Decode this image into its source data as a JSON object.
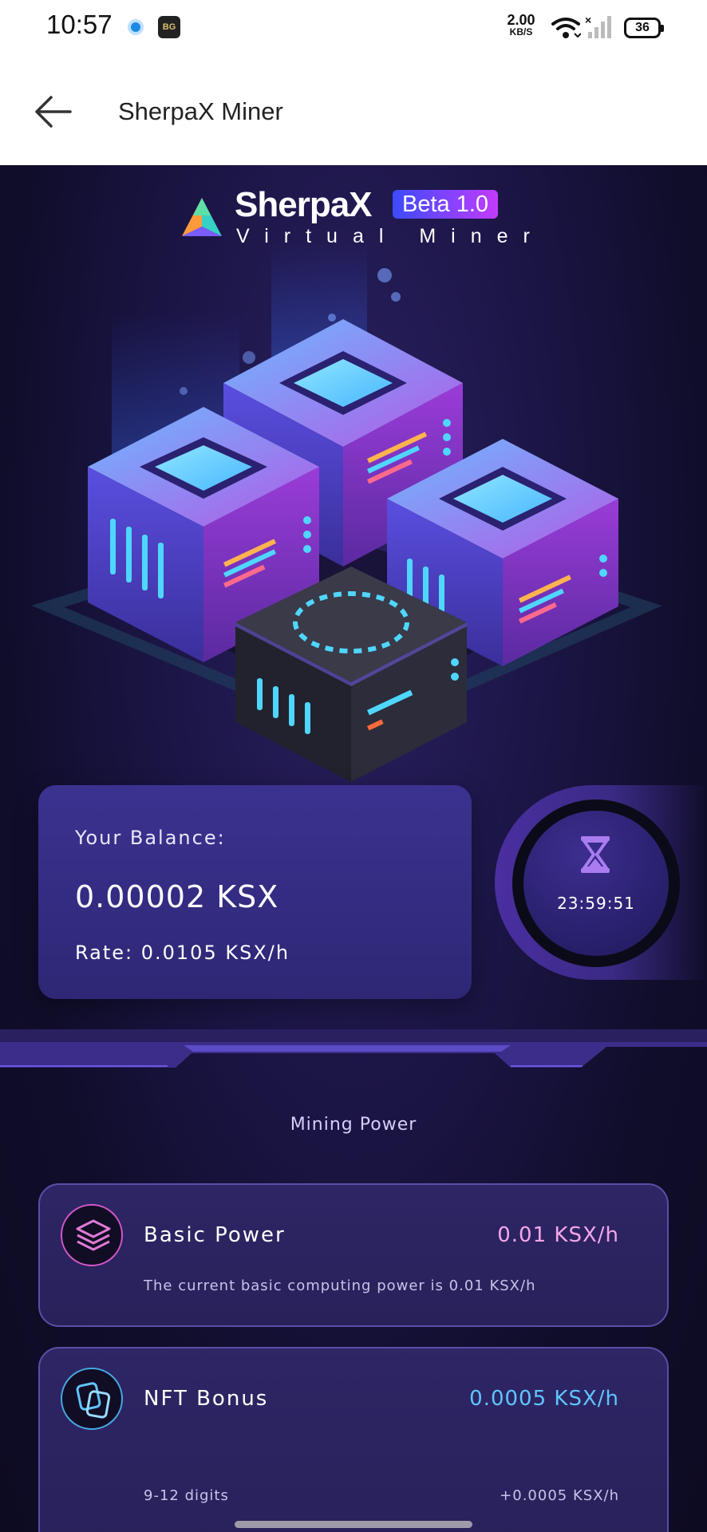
{
  "status_bar": {
    "time": "10:57",
    "app_icon_label": "BG",
    "net_speed_value": "2.00",
    "net_speed_unit": "KB/S",
    "battery": "36",
    "icons": [
      "location-icon",
      "app-icon",
      "wifi-icon",
      "signal-icon",
      "battery-icon"
    ]
  },
  "app_bar": {
    "title": "SherpaX Miner",
    "back_icon": "back-arrow-icon"
  },
  "logo": {
    "name": "SherpaX",
    "badge": "Beta 1.0",
    "subtitle": "Virtual Miner"
  },
  "balance": {
    "label": "Your Balance:",
    "value": "0.00002 KSX",
    "rate": "Rate: 0.0105 KSX/h"
  },
  "timer": {
    "icon": "hourglass-icon",
    "value": "23:59:51"
  },
  "mining_power": {
    "section_title": "Mining Power",
    "cards": [
      {
        "title": "Basic Power",
        "value": "0.01 KSX/h",
        "description": "The current basic computing power is 0.01 KSX/h",
        "icon": "layers-icon",
        "value_color": "#f4a6e9"
      },
      {
        "title": "NFT Bonus",
        "value": "0.0005 KSX/h",
        "detail_left": "9-12 digits",
        "detail_right": "+0.0005 KSX/h",
        "icon": "nft-icon",
        "value_color": "#5fc5ff"
      }
    ]
  },
  "colors": {
    "background": "#0d0b22",
    "card": "#2e2775",
    "accent_pink": "#d357c9",
    "accent_blue": "#47a9e4"
  }
}
